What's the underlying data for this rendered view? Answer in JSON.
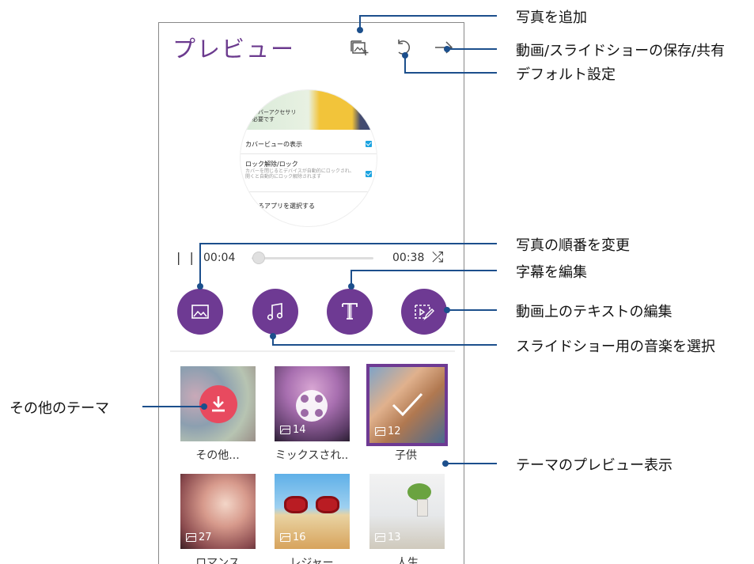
{
  "screen": {
    "title": "プレビュー",
    "toolbar": {
      "add_photo_icon": "add-photo-icon",
      "reset_icon": "reset-icon",
      "share_icon": "share-icon"
    }
  },
  "preview": {
    "top_text": "なカバーアクセサリ\nが必要です",
    "row1_label": "カバービューの表示",
    "row2_label": "ロック解除/ロック",
    "row2_sub": "カバーを閉じるとデバイスが自動的にロックされ、開くと自動的にロック解除されます",
    "row3_label": "るアプリを選択する"
  },
  "playback": {
    "pause_symbol": "| |",
    "current_time": "00:04",
    "total_time": "00:38",
    "shuffle_symbol": "⤮"
  },
  "themes": [
    {
      "label": "その他...",
      "count": "",
      "selected": false
    },
    {
      "label": "ミックスされ..",
      "count": "14",
      "selected": false
    },
    {
      "label": "子供",
      "count": "12",
      "selected": true
    },
    {
      "label": "ロマンス",
      "count": "27",
      "selected": false
    },
    {
      "label": "レジャー",
      "count": "16",
      "selected": false
    },
    {
      "label": "人生",
      "count": "13",
      "selected": false
    }
  ],
  "callouts": {
    "add_photo": "写真を追加",
    "save_share": "動画/スライドショーの保存/共有",
    "default": "デフォルト設定",
    "reorder": "写真の順番を変更",
    "caption": "字幕を編集",
    "text_edit": "動画上のテキストの編集",
    "music": "スライドショー用の音楽を選択",
    "other_themes": "その他のテーマ",
    "theme_preview": "テーマのプレビュー表示"
  },
  "colors": {
    "accent": "#6e3a93",
    "callout_line": "#1c4f8c",
    "download": "#e84a5f",
    "check": "#1ba3e0"
  }
}
